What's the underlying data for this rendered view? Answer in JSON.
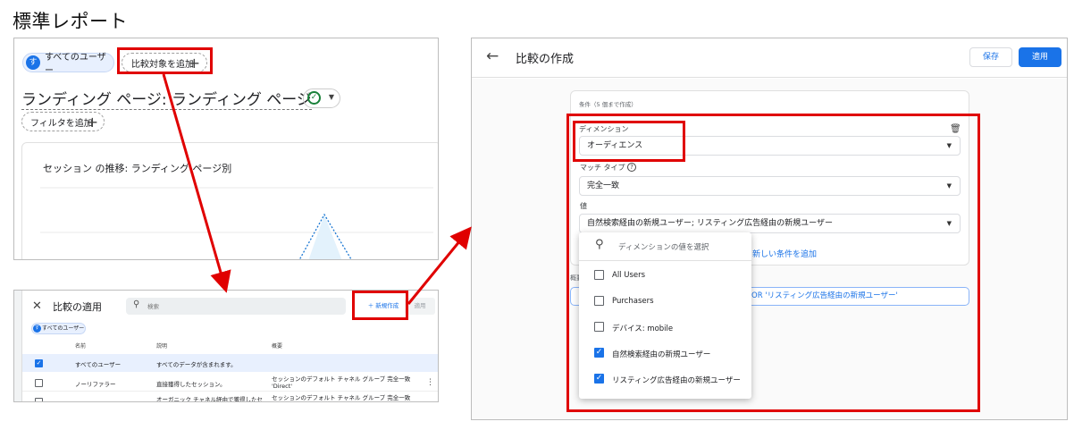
{
  "doc_title": "標準レポート",
  "panel1": {
    "all_users_avatar": "す",
    "all_users_chip": "すべてのユーザー",
    "add_comparison_chip": "比較対象を追加",
    "heading": "ランディング ページ: ランディング ページ",
    "add_filter_chip": "フィルタを追加",
    "card_title": "セッション の推移: ランディング ページ別"
  },
  "panel2": {
    "title": "比較の適用",
    "search_placeholder": "検索",
    "new_button": "＋ 新規作成",
    "apply_button": "適用",
    "chip": "すべてのユーザー",
    "chip_avatar": "す",
    "columns": [
      "名前",
      "説明",
      "概要"
    ],
    "rows": [
      {
        "checked": true,
        "name": "すべてのユーザー",
        "description": "すべてのデータが含まれます。",
        "summary": ""
      },
      {
        "checked": false,
        "name": "ノーリファラー",
        "description": "直接獲得したセッション。",
        "summary": "セッションのデフォルト チャネル グループ 完全一致 'Direct'"
      },
      {
        "checked": false,
        "name": "",
        "description": "オーガニック チャネル経由で獲得したセ",
        "summary": "セッションのデフォルト チャネル グループ 完全一致"
      }
    ]
  },
  "panel3": {
    "title": "比較の作成",
    "save_button": "保存",
    "apply_button": "適用",
    "conditions_label": "条件（5 個まで作成）",
    "dimension_label": "ディメンション",
    "dimension_value": "オーディエンス",
    "match_type_label": "マッチ タイプ",
    "match_type_value": "完全一致",
    "value_label": "値",
    "value_value": "自然検索経由の新規ユーザー; リスティング広告経由の新規ユーザー",
    "add_condition": "新しい条件を追加",
    "summary_label": "概要",
    "summary_text": "ザー' OR 'リスティング広告経由の新規ユーザー'",
    "dropdown": {
      "search_placeholder": "ディメンションの値を選択",
      "options": [
        {
          "label": "All Users",
          "checked": false
        },
        {
          "label": "Purchasers",
          "checked": false
        },
        {
          "label": "デバイス: mobile",
          "checked": false
        },
        {
          "label": "自然検索経由の新規ユーザー",
          "checked": true
        },
        {
          "label": "リスティング広告経由の新規ユーザー",
          "checked": true
        }
      ]
    }
  },
  "colors": {
    "accent": "#1a73e8",
    "highlight": "#e00000",
    "chart_fill": "#e3f2fc"
  }
}
